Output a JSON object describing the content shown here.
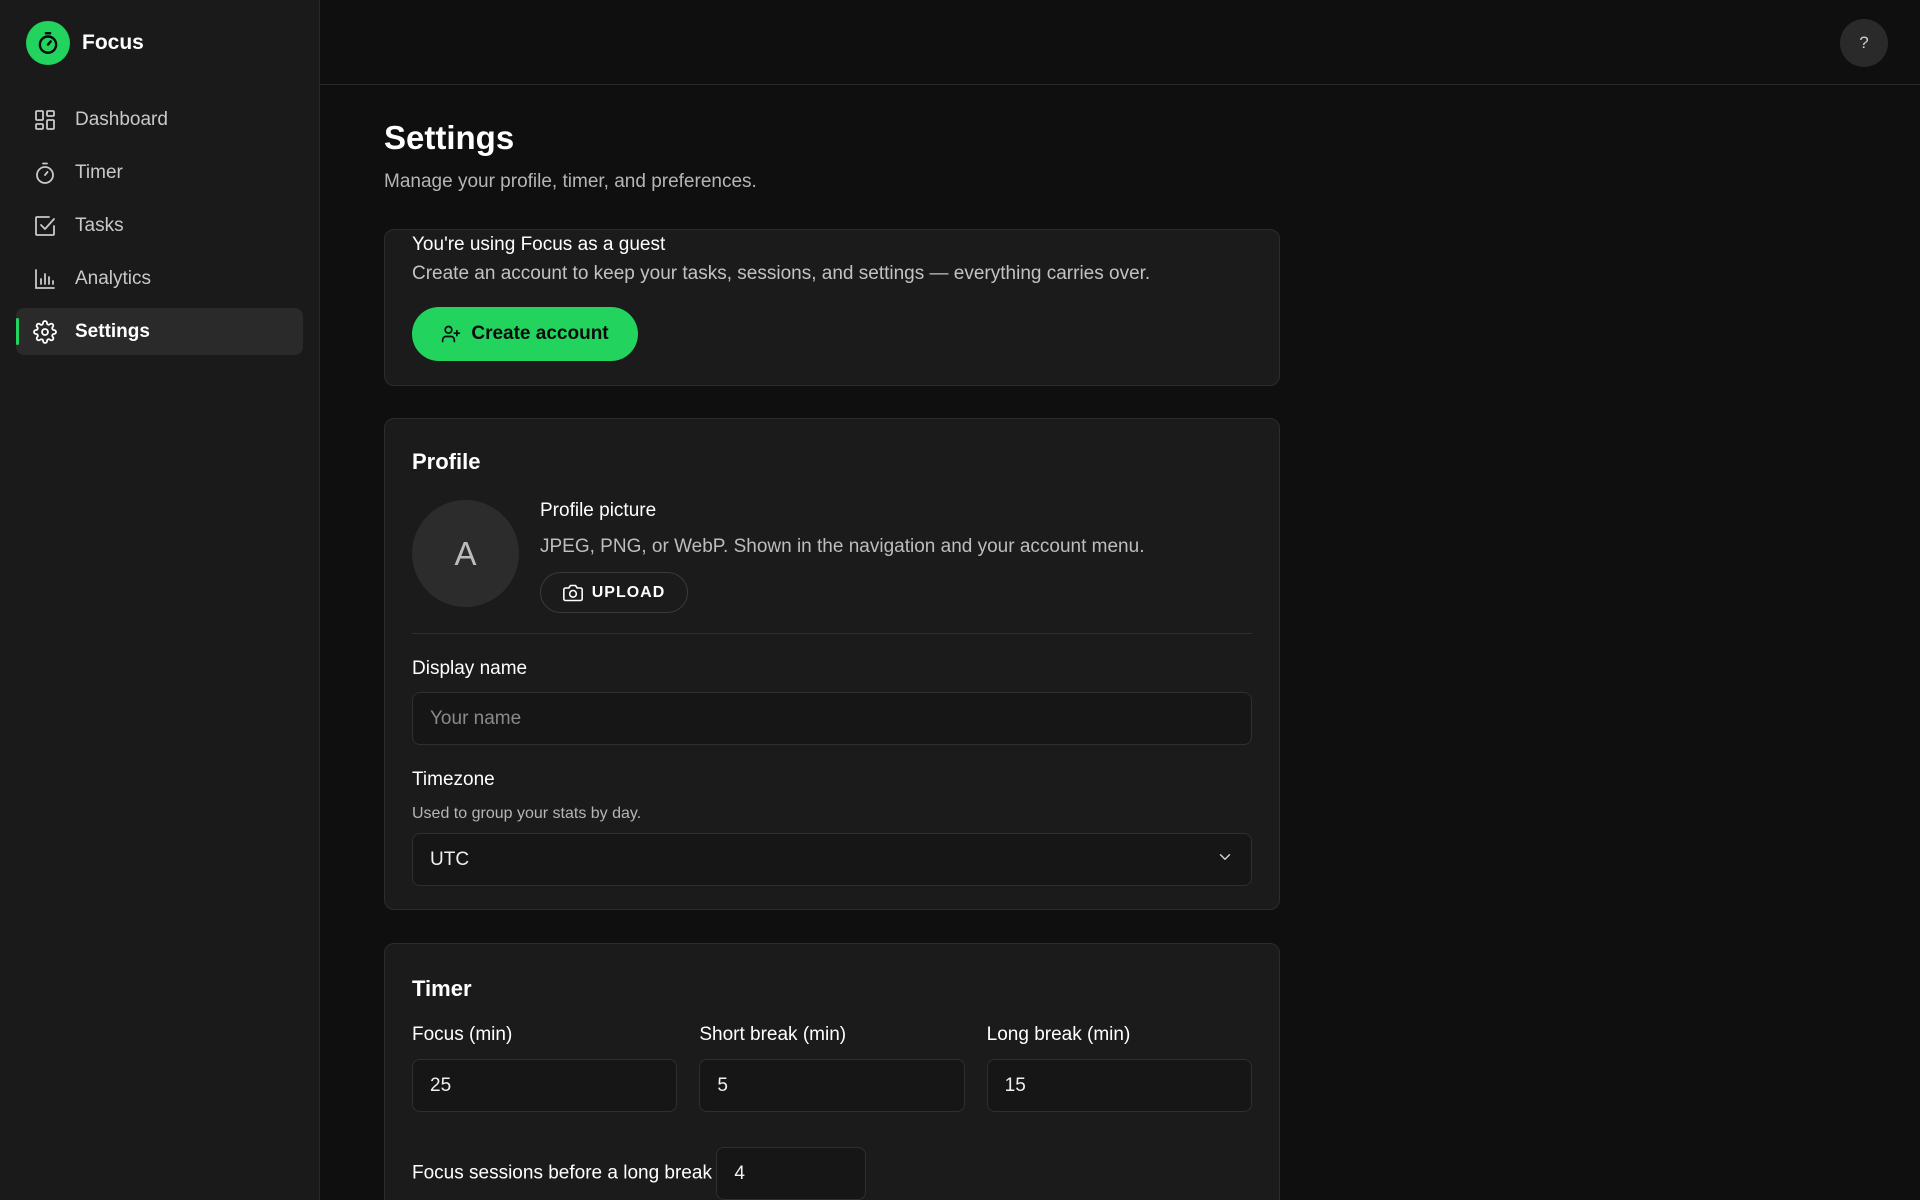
{
  "brand": {
    "name": "Focus"
  },
  "sidebar": {
    "items": [
      {
        "label": "Dashboard",
        "icon": "dashboard-icon",
        "active": false
      },
      {
        "label": "Timer",
        "icon": "stopwatch-icon",
        "active": false
      },
      {
        "label": "Tasks",
        "icon": "checkbox-icon",
        "active": false
      },
      {
        "label": "Analytics",
        "icon": "bar-chart-icon",
        "active": false
      },
      {
        "label": "Settings",
        "icon": "gear-icon",
        "active": true
      }
    ]
  },
  "header": {
    "help_label": "?"
  },
  "page": {
    "title": "Settings",
    "subtitle": "Manage your profile, timer, and preferences."
  },
  "guest": {
    "title": "You're using Focus as a guest",
    "description": "Create an account to keep your tasks, sessions, and settings — everything carries over.",
    "create_label": "Create account"
  },
  "profile": {
    "section_title": "Profile",
    "avatar_initial": "A",
    "picture_title": "Profile picture",
    "picture_desc": "JPEG, PNG, or WebP. Shown in the navigation and your account menu.",
    "upload_label": "UPLOAD",
    "display_name_label": "Display name",
    "display_name_placeholder": "Your name",
    "display_name_value": "",
    "timezone_label": "Timezone",
    "timezone_help": "Used to group your stats by day.",
    "timezone_value": "UTC"
  },
  "timer": {
    "section_title": "Timer",
    "focus_label": "Focus (min)",
    "focus_value": "25",
    "short_break_label": "Short break (min)",
    "short_break_value": "5",
    "long_break_label": "Long break (min)",
    "long_break_value": "15",
    "sessions_label": "Focus sessions before a long break",
    "sessions_value": "4"
  },
  "colors": {
    "accent": "#22d35e",
    "background": "#0f0f0f",
    "sidebar": "#1a1a1a",
    "card": "#1b1b1b"
  }
}
